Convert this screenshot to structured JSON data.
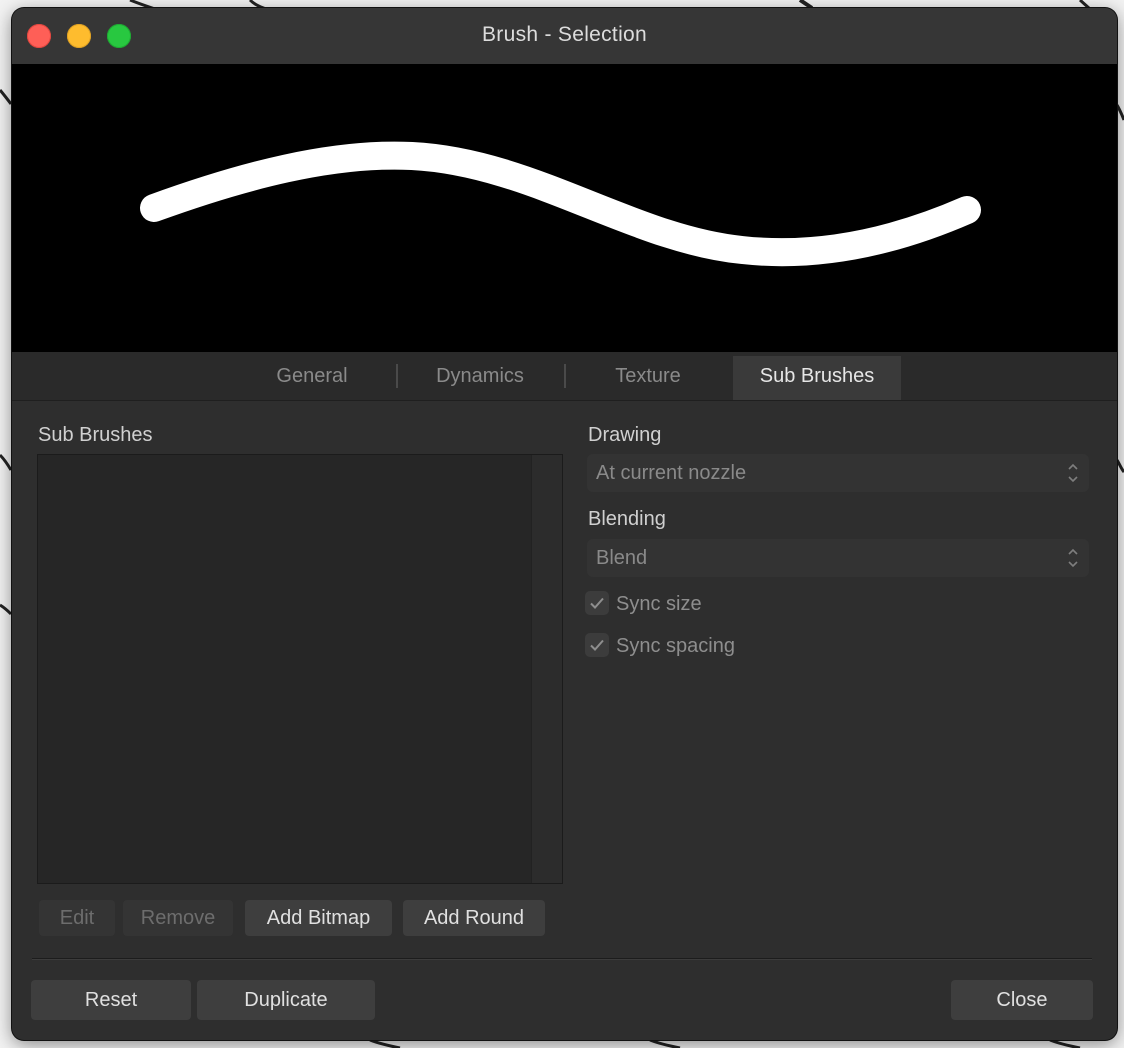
{
  "window": {
    "title": "Brush - Selection"
  },
  "tabs": [
    {
      "label": "General",
      "active": false
    },
    {
      "label": "Dynamics",
      "active": false
    },
    {
      "label": "Texture",
      "active": false
    },
    {
      "label": "Sub Brushes",
      "active": true
    }
  ],
  "sub_brushes": {
    "header": "Sub Brushes",
    "items": [],
    "buttons": {
      "edit": {
        "label": "Edit",
        "enabled": false
      },
      "remove": {
        "label": "Remove",
        "enabled": false
      },
      "add_bitmap": {
        "label": "Add Bitmap",
        "enabled": true
      },
      "add_round": {
        "label": "Add Round",
        "enabled": true
      }
    }
  },
  "drawing": {
    "label": "Drawing",
    "value": "At current nozzle"
  },
  "blending": {
    "label": "Blending",
    "value": "Blend"
  },
  "options": {
    "sync_size": {
      "label": "Sync size",
      "checked": true
    },
    "sync_spacing": {
      "label": "Sync spacing",
      "checked": true
    }
  },
  "footer": {
    "reset": "Reset",
    "duplicate": "Duplicate",
    "close": "Close"
  },
  "colors": {
    "window_bg": "#2e2e2e",
    "preview_bg": "#000000",
    "stroke": "#ffffff",
    "traffic_red": "#fe5f57",
    "traffic_yellow": "#febc2e",
    "traffic_green": "#28c840"
  },
  "icons": {
    "close": "close-icon",
    "minimize": "minimize-icon",
    "zoom": "zoom-icon",
    "select_chevron": "chevron-updown-icon",
    "checkmark": "checkmark-icon"
  }
}
